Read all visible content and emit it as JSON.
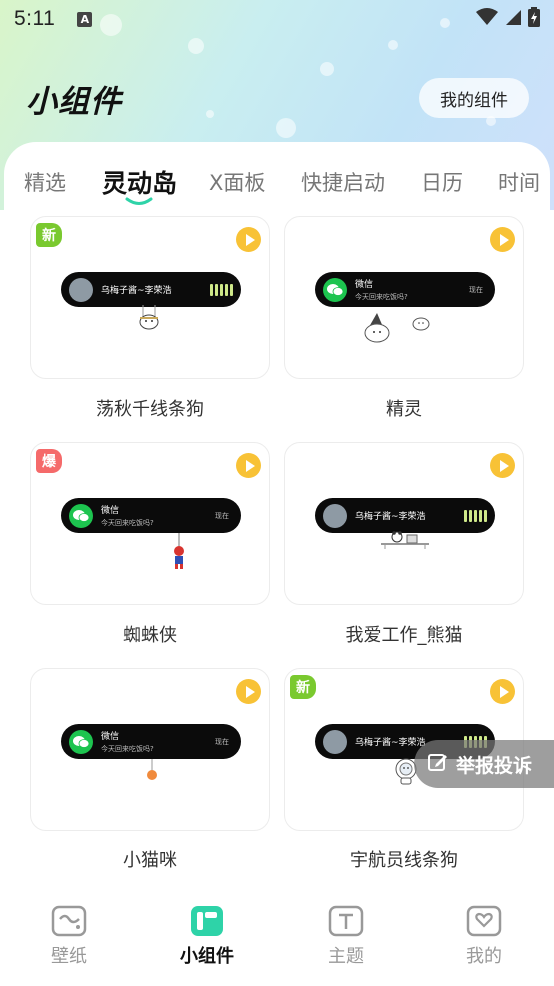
{
  "status_bar": {
    "time": "5:11",
    "notification_icon_letter": "A"
  },
  "header": {
    "title": "小组件",
    "my_widgets_label": "我的组件"
  },
  "tabs": [
    {
      "label": "精选",
      "active": false
    },
    {
      "label": "灵动岛",
      "active": true
    },
    {
      "label": "X面板",
      "active": false
    },
    {
      "label": "快捷启动",
      "active": false
    },
    {
      "label": "日历",
      "active": false
    },
    {
      "label": "时间",
      "active": false
    }
  ],
  "cards": [
    {
      "label": "荡秋千线条狗",
      "badge": "新",
      "badge_type": "new",
      "island": "music",
      "track": "乌梅子酱~李荣浩"
    },
    {
      "label": "精灵",
      "badge": "",
      "badge_type": "",
      "island": "message",
      "msg_title": "微信",
      "msg_body": "今天回来吃饭吗?",
      "msg_time": "现在"
    },
    {
      "label": "蜘蛛侠",
      "badge": "爆",
      "badge_type": "hot",
      "island": "message",
      "msg_title": "微信",
      "msg_body": "今天回来吃饭吗?",
      "msg_time": "现在"
    },
    {
      "label": "我爱工作_熊猫",
      "badge": "",
      "badge_type": "",
      "island": "music",
      "track": "乌梅子酱~李荣浩"
    },
    {
      "label": "小猫咪",
      "badge": "",
      "badge_type": "",
      "island": "message",
      "msg_title": "微信",
      "msg_body": "今天回来吃饭吗?",
      "msg_time": "现在"
    },
    {
      "label": "宇航员线条狗",
      "badge": "新",
      "badge_type": "new",
      "island": "music",
      "track": "乌梅子酱~李荣浩"
    }
  ],
  "report_button_label": "举报投诉",
  "bottom_nav": [
    {
      "label": "壁纸",
      "icon": "wallpaper-icon",
      "active": false
    },
    {
      "label": "小组件",
      "icon": "widget-icon",
      "active": true
    },
    {
      "label": "主题",
      "icon": "theme-icon",
      "active": false
    },
    {
      "label": "我的",
      "icon": "profile-icon",
      "active": false
    }
  ],
  "colors": {
    "accent_green": "#7ac92f",
    "hot_red": "#f56a6a",
    "play_yellow": "#f8c236",
    "wechat_green": "#1dc44f",
    "widget_icon_teal": "#2ed3a8"
  }
}
